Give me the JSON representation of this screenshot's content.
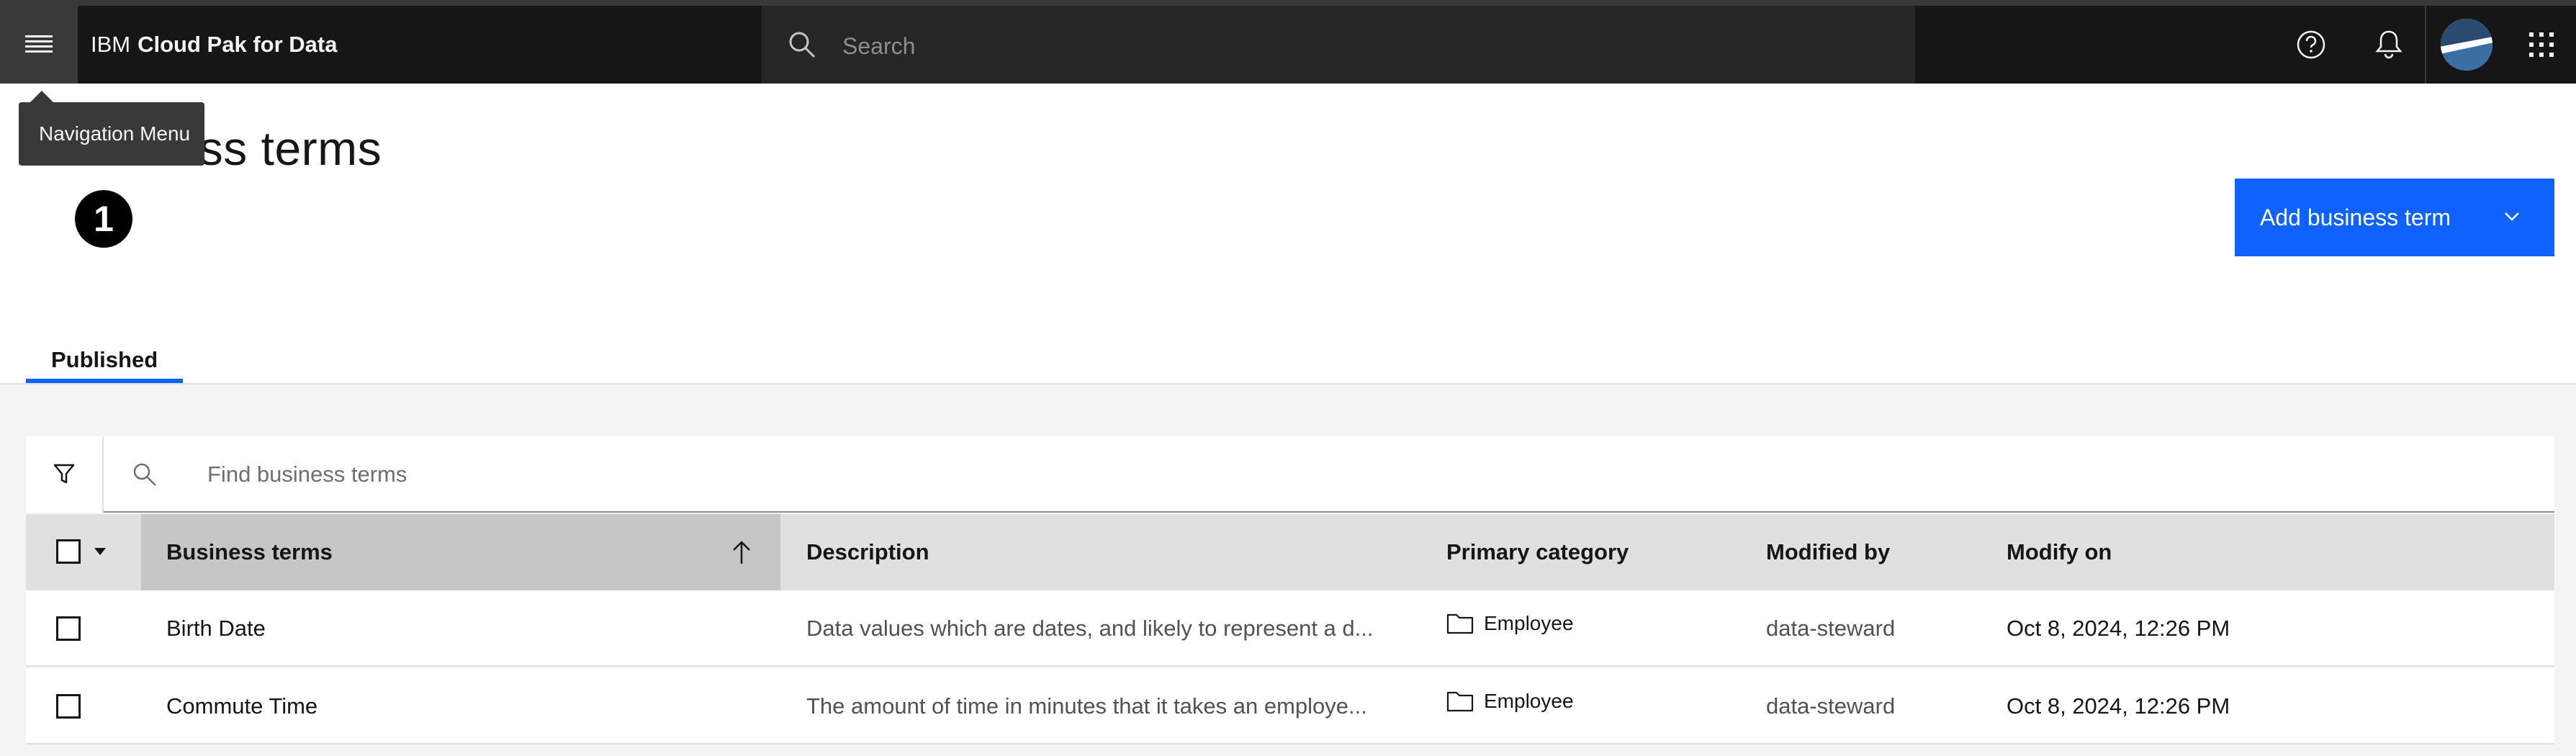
{
  "header": {
    "brand_prefix": "IBM",
    "brand_product": "Cloud Pak for Data",
    "search_placeholder": "Search"
  },
  "tooltip": {
    "text": "Navigation Menu"
  },
  "page": {
    "title": "Business terms",
    "step_badge": "1",
    "add_button_label": "Add business term"
  },
  "tabs": [
    {
      "label": "Published",
      "selected": true
    }
  ],
  "toolbar": {
    "find_placeholder": "Find business terms"
  },
  "table": {
    "columns": [
      "Business terms",
      "Description",
      "Primary category",
      "Modified by",
      "Modify on"
    ],
    "sort": {
      "column": "Business terms",
      "direction": "ascending"
    },
    "rows": [
      {
        "term": "Birth Date",
        "description": "Data values which are dates, and likely to represent a d...",
        "category": "Employee",
        "modified_by": "data-steward",
        "modified_on": "Oct 8, 2024, 12:26 PM"
      },
      {
        "term": "Commute Time",
        "description": "The amount of time in minutes that it takes an employe...",
        "category": "Employee",
        "modified_by": "data-steward",
        "modified_on": "Oct 8, 2024, 12:26 PM"
      }
    ]
  },
  "colors": {
    "header_bg": "#161616",
    "primary_button": "#0f62fe",
    "tab_indicator": "#0f62fe",
    "content_bg": "#f4f4f4"
  },
  "icons": [
    "menu-icon",
    "search-icon",
    "help-icon",
    "notification-bell-icon",
    "avatar",
    "app-switcher-icon",
    "chevron-down-icon",
    "filter-icon",
    "sort-arrow-up-icon",
    "folder-icon",
    "caret-down-icon"
  ]
}
